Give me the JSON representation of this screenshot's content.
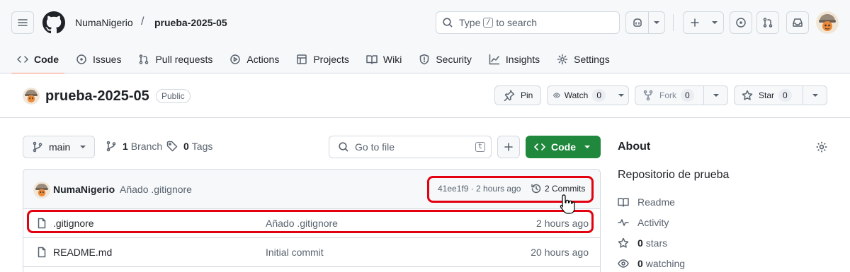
{
  "header": {
    "owner": "NumaNigerio",
    "separator": "/",
    "repo": "prueba-2025-05",
    "search": {
      "prefix": "Type",
      "key": "/",
      "suffix": "to search"
    }
  },
  "nav": {
    "tabs": [
      {
        "label": "Code",
        "icon": "code-icon",
        "selected": true
      },
      {
        "label": "Issues",
        "icon": "issue-icon"
      },
      {
        "label": "Pull requests",
        "icon": "pull-request-icon"
      },
      {
        "label": "Actions",
        "icon": "play-icon"
      },
      {
        "label": "Projects",
        "icon": "table-icon"
      },
      {
        "label": "Wiki",
        "icon": "book-icon"
      },
      {
        "label": "Security",
        "icon": "shield-icon"
      },
      {
        "label": "Insights",
        "icon": "graph-icon"
      },
      {
        "label": "Settings",
        "icon": "gear-icon"
      }
    ]
  },
  "repo_header": {
    "name": "prueba-2025-05",
    "visibility": "Public",
    "pin_label": "Pin",
    "watch": {
      "label": "Watch",
      "count": "0"
    },
    "fork": {
      "label": "Fork",
      "count": "0"
    },
    "star": {
      "label": "Star",
      "count": "0"
    }
  },
  "toolbar": {
    "branch": "main",
    "branches": {
      "count": "1",
      "label": "Branch"
    },
    "tags": {
      "count": "0",
      "label": "Tags"
    },
    "goto_placeholder": "Go to file",
    "goto_key": "t",
    "code_label": "Code"
  },
  "latest_commit": {
    "author": "NumaNigerio",
    "message": "Añado .gitignore",
    "hash_time": "41ee1f9 · 2 hours ago",
    "commits_label": "2 Commits"
  },
  "files": [
    {
      "name": ".gitignore",
      "message": "Añado .gitignore",
      "date": "2 hours ago",
      "icon": "file-icon"
    },
    {
      "name": "README.md",
      "message": "Initial commit",
      "date": "20 hours ago",
      "icon": "file-icon"
    }
  ],
  "about": {
    "title": "About",
    "description": "Repositorio de prueba",
    "readme": "Readme",
    "activity": "Activity",
    "stars": {
      "count": "0",
      "label": "stars"
    },
    "watching": {
      "count": "0",
      "label": "watching"
    }
  },
  "colors": {
    "accent_green": "#1f883d",
    "tab_underline": "#fd8c73",
    "highlight": "#e3000f"
  }
}
